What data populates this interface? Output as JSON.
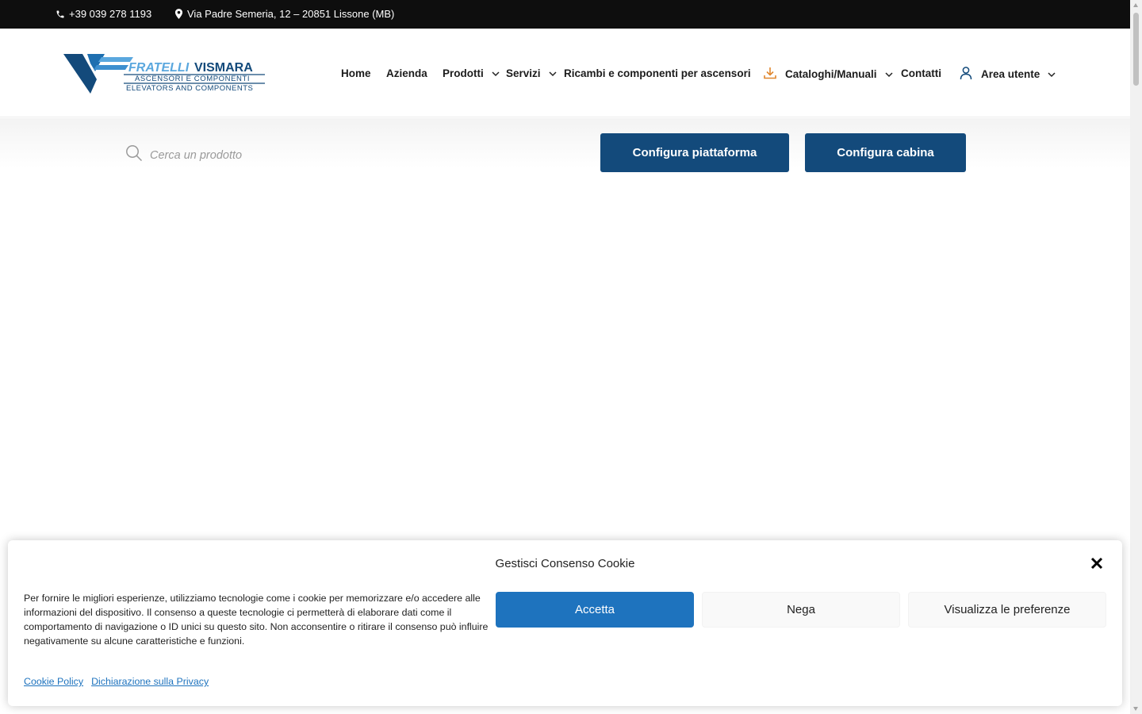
{
  "topbar": {
    "phone": "+39 039 278 1193",
    "address": "Via Padre Semeria, 12 – 20851 Lissone (MB)"
  },
  "logo": {
    "line1": "FRATELLI VISMARA",
    "line2": "ASCENSORI E COMPONENTI",
    "line3": "ELEVATORS AND COMPONENTS"
  },
  "nav": {
    "home": "Home",
    "azienda": "Azienda",
    "prodotti": "Prodotti",
    "servizi": "Servizi",
    "ricambi": "Ricambi e componenti per ascensori",
    "cataloghi": "Cataloghi/Manuali",
    "contatti": "Contatti",
    "area_utente": "Area utente"
  },
  "search": {
    "placeholder": "Cerca un prodotto"
  },
  "actions": {
    "configura_piattaforma": "Configura piattaforma",
    "configura_cabina": "Configura cabina"
  },
  "cookie": {
    "title": "Gestisci Consenso Cookie",
    "message": "Per fornire le migliori esperienze, utilizziamo tecnologie come i cookie per memorizzare e/o accedere alle informazioni del dispositivo. Il consenso a queste tecnologie ci permetterà di elaborare dati come il comportamento di navigazione o ID unici su questo sito. Non acconsentire o ritirare il consenso può influire negativamente su alcune caratteristiche e funzioni.",
    "accept": "Accetta",
    "deny": "Nega",
    "preferences": "Visualizza le preferenze",
    "cookie_policy": "Cookie Policy",
    "privacy": "Dichiarazione sulla Privacy"
  },
  "colors": {
    "brand_blue": "#134a7b",
    "accent_orange": "#e0872f",
    "cookie_primary": "#1e73be",
    "topbar": "#0e0e0e"
  }
}
